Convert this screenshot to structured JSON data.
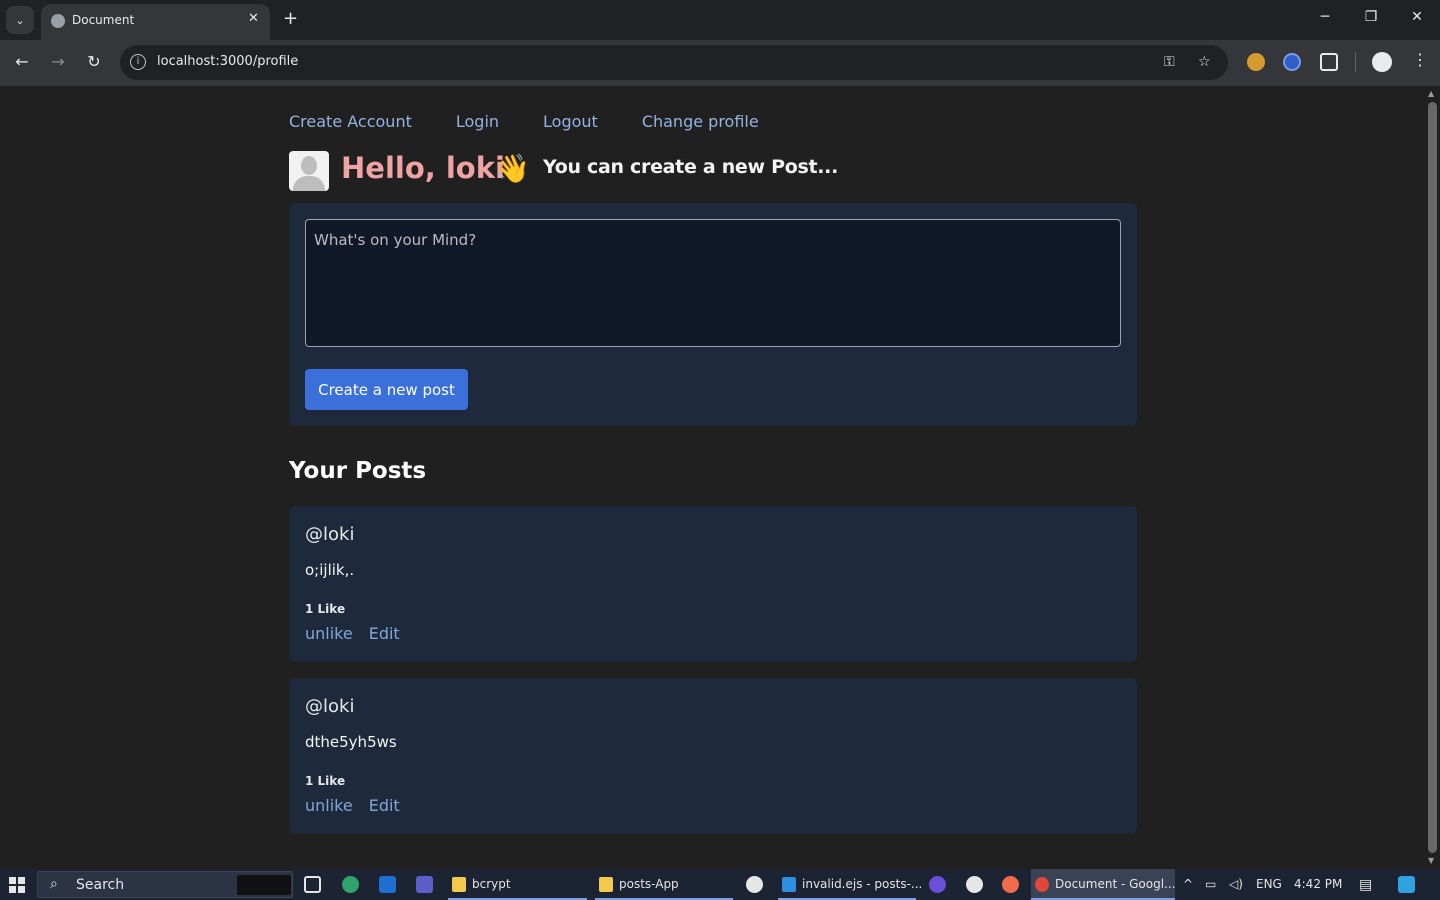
{
  "browser": {
    "tab_title": "Document",
    "tab_close": "✕",
    "new_tab": "+",
    "url": "localhost:3000/profile",
    "win_minimize": "─",
    "win_restore": "❐",
    "win_close": "✕"
  },
  "nav": {
    "links": [
      "Create Account",
      "Login",
      "Logout",
      "Change profile"
    ]
  },
  "header": {
    "greeting": "Hello, loki",
    "wave_emoji": "👋",
    "subtitle": "You can create a new Post..."
  },
  "composer": {
    "placeholder": "What's on your Mind?",
    "value": "",
    "submit_label": "Create a new post"
  },
  "posts_heading": "Your Posts",
  "posts": [
    {
      "author": "@loki",
      "content": "o;ijlik,.",
      "likes": "1 Like",
      "unlike_label": "unlike",
      "edit_label": "Edit"
    },
    {
      "author": "@loki",
      "content": "dthe5yh5ws",
      "likes": "1 Like",
      "unlike_label": "unlike",
      "edit_label": "Edit"
    }
  ],
  "taskbar": {
    "search_label": "Search",
    "apps": [
      {
        "label": "bcrypt"
      },
      {
        "label": "posts-App"
      },
      {
        "label": "invalid.ejs - posts-..."
      },
      {
        "label": "Document - Googl..."
      }
    ],
    "language": "ENG",
    "time": "4:42 PM"
  },
  "colors": {
    "page_bg": "#202020",
    "card_bg": "#1e293b",
    "link": "#93b3e3",
    "greeting": "#f0a3a3",
    "button": "#3b6fd9"
  },
  "icons": [
    "tab-search-icon",
    "favicon-icon",
    "close-icon",
    "plus-icon",
    "back-icon",
    "forward-icon",
    "reload-icon",
    "site-info-icon",
    "password-key-icon",
    "bookmark-star-icon",
    "extensions-icon",
    "profile-icon",
    "menu-icon",
    "windows-start-icon",
    "search-icon"
  ]
}
